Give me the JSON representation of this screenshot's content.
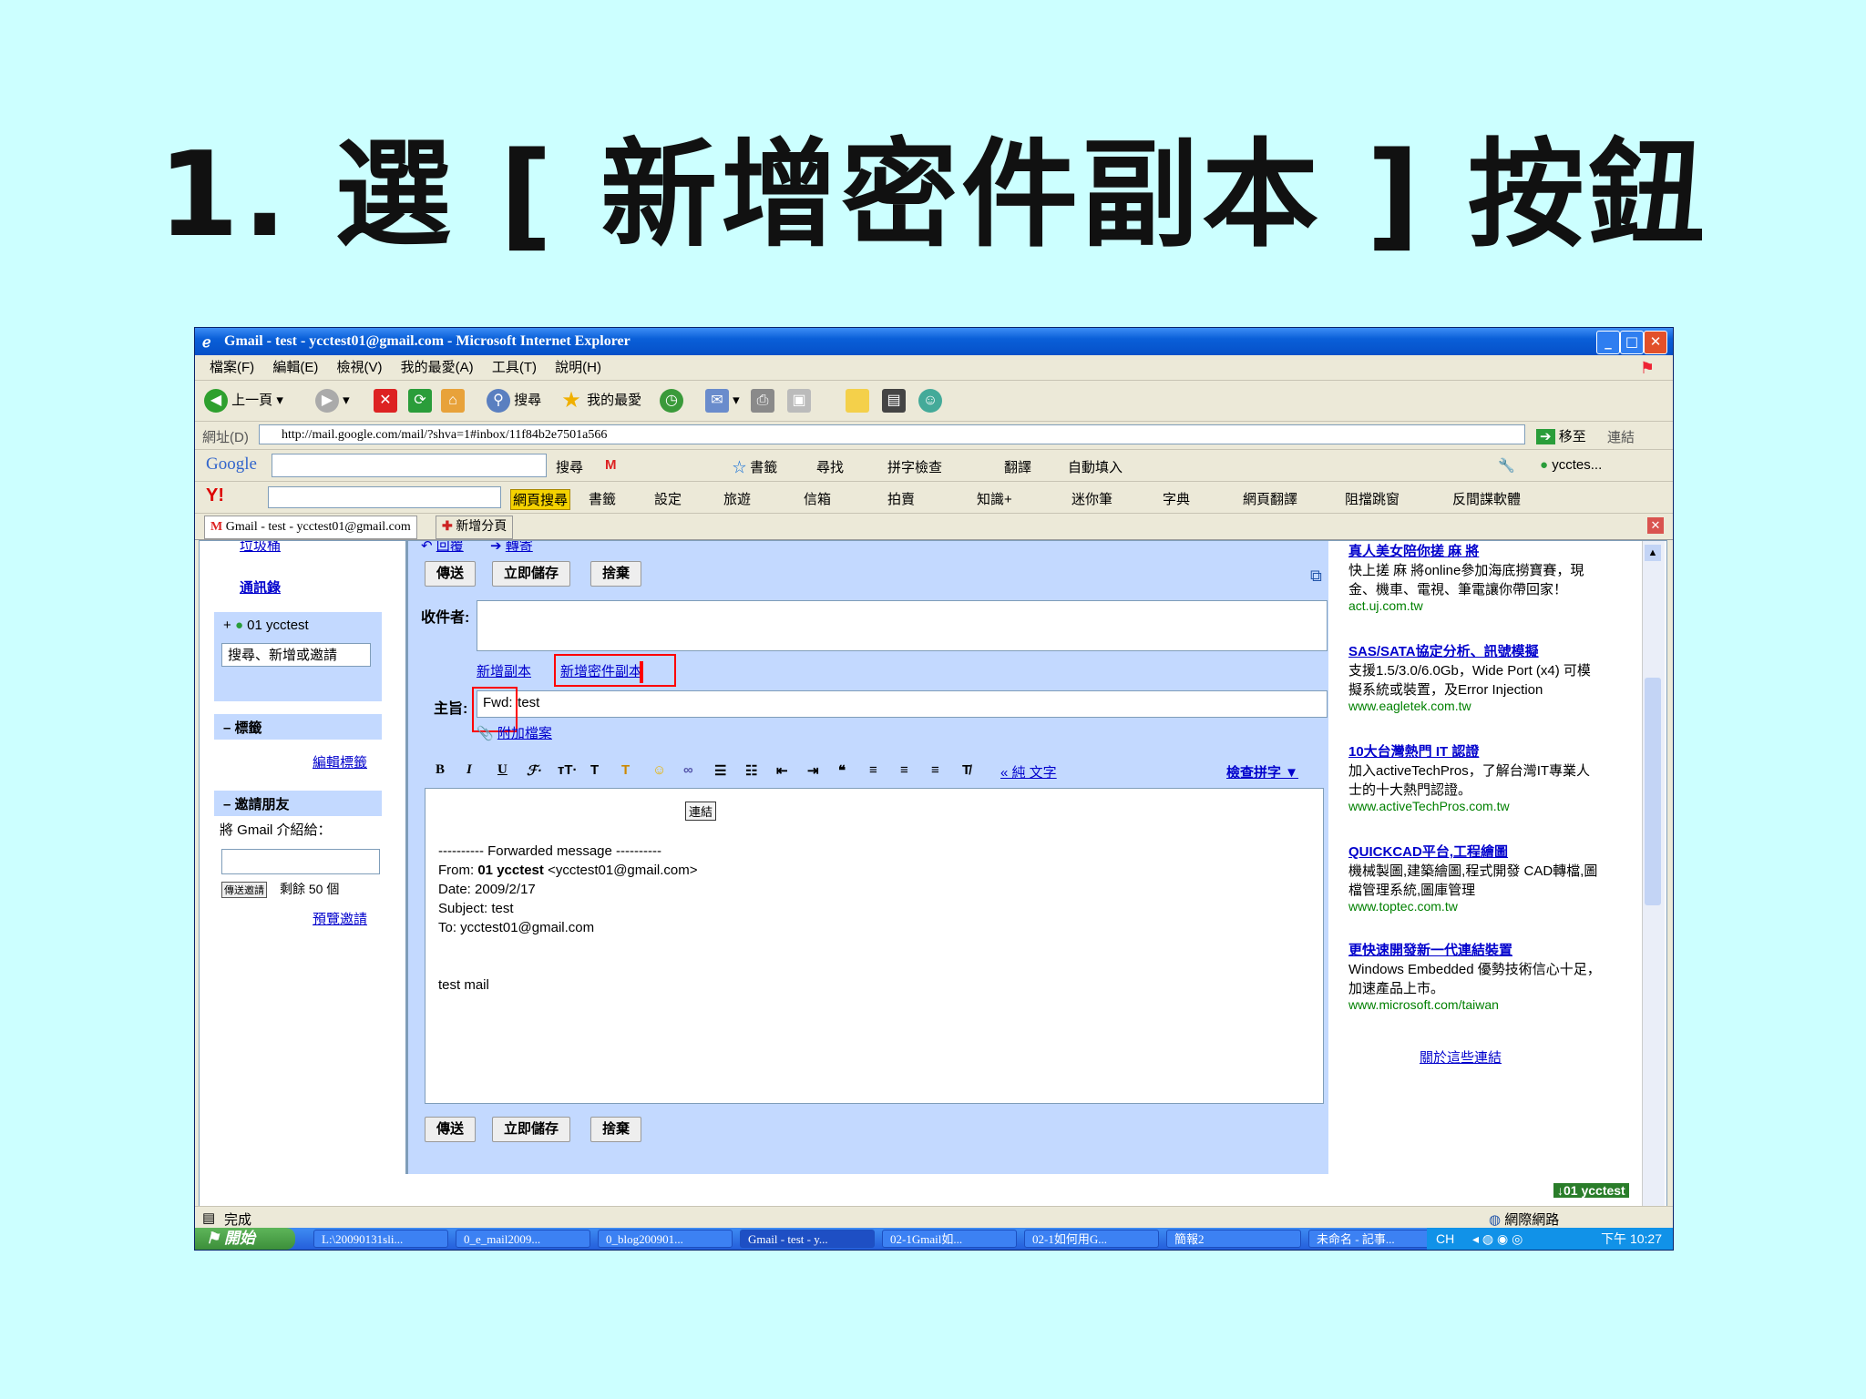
{
  "slide": {
    "title": "1. 選 [ 新增密件副本 ] 按鈕"
  },
  "window": {
    "title": "Gmail - test - ycctest01@gmail.com - Microsoft Internet Explorer",
    "menus": [
      "檔案(F)",
      "編輯(E)",
      "檢視(V)",
      "我的最愛(A)",
      "工具(T)",
      "說明(H)"
    ],
    "toolbar": {
      "back": "上一頁",
      "search": "搜尋",
      "favorites": "我的最愛"
    },
    "address": {
      "label": "網址(D)",
      "url": "http://mail.google.com/mail/?shva=1#inbox/11f84b2e7501a566",
      "go": "移至",
      "links": "連結"
    },
    "google_bar": {
      "search": "搜尋",
      "bookmarks": "書籤",
      "find": "尋找",
      "spellcheck": "拼字檢查",
      "translate": "翻譯",
      "autofill": "自動填入",
      "account": "ycctes..."
    },
    "yahoo_bar": {
      "web_search": "網頁搜尋",
      "bookmarks": "書籤",
      "settings": "設定",
      "travel": "旅遊",
      "mail": "信箱",
      "auction": "拍賣",
      "knowledge": "知識+",
      "fans": "迷你筆",
      "dictionary": "字典",
      "web_translate": "網頁翻譯",
      "popup_block": "阻擋跳窗",
      "antispy": "反間諜軟體"
    },
    "tabs": {
      "current": "Gmail - test - ycctest01@gmail.com",
      "new_tab": "新增分頁"
    }
  },
  "gmail": {
    "left": {
      "trash": "垃圾桶",
      "contacts": "通訊錄",
      "chat_user": "01 ycctest",
      "chat_search": "搜尋、新增或邀請",
      "labels_header": "標籤",
      "edit_labels": "編輯標籤",
      "invite_header": "邀請朋友",
      "invite_text": "將 Gmail 介紹給：",
      "invite_button": "傳送邀請",
      "invites_left": "剩餘 50 個",
      "preview_invite": "預覽邀請"
    },
    "compose": {
      "reply": "回覆",
      "forward": "轉寄",
      "send": "傳送",
      "save_now": "立即儲存",
      "discard": "捨棄",
      "to_label": "收件者:",
      "add_cc": "新增副本",
      "add_bcc": "新增密件副本",
      "subject_label": "主旨:",
      "subject_prefix": "Fwd:",
      "subject_rest": " test",
      "attach": "附加檔案",
      "plain_text": "« 純 文字",
      "spell_check": "檢查拼字 ▼",
      "link_tag": "連結",
      "body": {
        "line1": "---------- Forwarded message ----------",
        "from_label": "From: ",
        "from_name": "01 ycctest",
        "from_email": " <ycctest01@gmail.com>",
        "date": "Date: 2009/2/17",
        "subject": "Subject: test",
        "to": "To: ycctest01@gmail.com",
        "text": "test mail"
      }
    },
    "ads": [
      {
        "headline": "真人美女陪你搓 麻 將",
        "text": "快上搓 麻 將online參加海底撈寶賽，現金、機車、電視、筆電讓你帶回家！",
        "url": "act.uj.com.tw"
      },
      {
        "headline": "SAS/SATA協定分析、訊號模擬",
        "text": "支援1.5/3.0/6.0Gb，Wide Port (x4) 可模擬系統或裝置，及Error Injection",
        "url": "www.eagletek.com.tw"
      },
      {
        "headline": "10大台灣熱門 IT 認證",
        "text": "加入activeTechPros，了解台灣IT專業人士的十大熱門認證。",
        "url": "www.activeTechPros.com.tw"
      },
      {
        "headline": "QUICKCAD平台,工程繪圖",
        "text": "機械製圖,建築繪圖,程式開發 CAD轉檔,圖檔管理系統,圖庫管理",
        "url": "www.toptec.com.tw"
      },
      {
        "headline": "更快速開發新一代連結裝置",
        "text": "Windows Embedded 優勢技術信心十足，加速產品上市。",
        "url": "www.microsoft.com/taiwan"
      }
    ],
    "about_links": "關於這些連結",
    "chat_popup": "01 ycctest"
  },
  "status": {
    "text": "完成",
    "zone": "網際網路"
  },
  "taskbar": {
    "start": "開始",
    "tasks": [
      "L:\\20090131sli...",
      "0_e_mail2009...",
      "0_blog200901...",
      "Gmail - test - y...",
      "02-1Gmail如...",
      "02-1如何用G...",
      "簡報2",
      "未命名 - 記事..."
    ],
    "lang": "CH",
    "time": "下午 10:27"
  },
  "colors": {
    "slide_bg": "#ccffff",
    "highlight": "#ff0000",
    "gmail_blue": "#c3d9ff",
    "link": "#0000cc"
  }
}
